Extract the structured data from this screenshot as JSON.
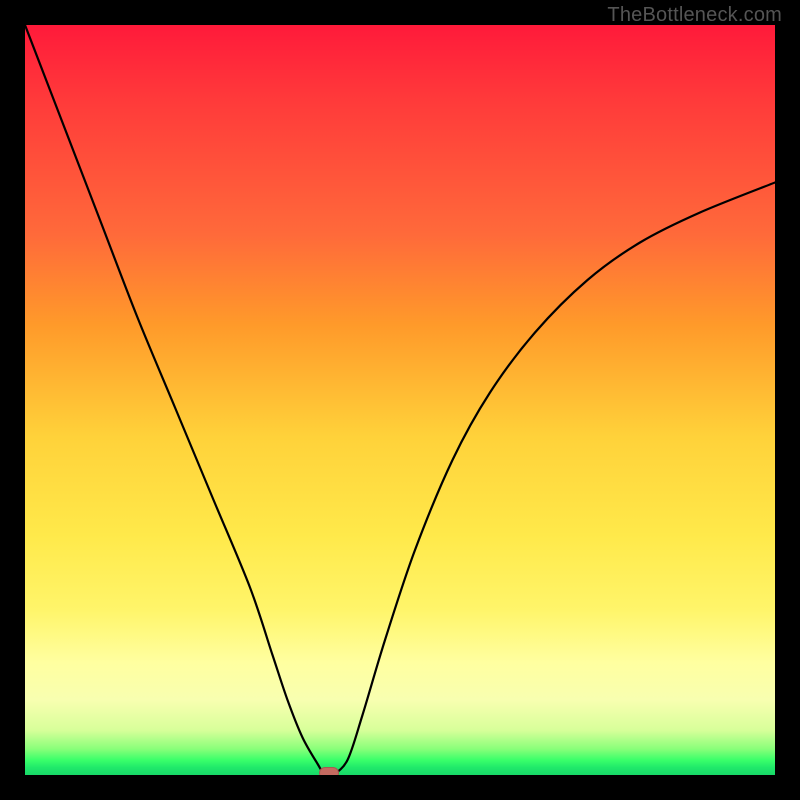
{
  "watermark": "TheBottleneck.com",
  "colors": {
    "background": "#000000",
    "gradient_top": "#ff1a3a",
    "gradient_mid": "#ffe94a",
    "gradient_bottom": "#18d868",
    "curve": "#000000",
    "marker": "#c46a60"
  },
  "chart_data": {
    "type": "line",
    "title": "",
    "xlabel": "",
    "ylabel": "",
    "xlim": [
      0,
      100
    ],
    "ylim": [
      0,
      100
    ],
    "grid": false,
    "legend": false,
    "series": [
      {
        "name": "bottleneck-curve",
        "x": [
          0,
          5,
          10,
          15,
          20,
          25,
          30,
          33,
          35,
          37,
          39,
          40,
          41,
          43,
          45,
          48,
          52,
          57,
          62,
          68,
          75,
          82,
          90,
          100
        ],
        "values": [
          100,
          87,
          74,
          61,
          49,
          37,
          25,
          16,
          10,
          5,
          1.5,
          0,
          0,
          2,
          8,
          18,
          30,
          42,
          51,
          59,
          66,
          71,
          75,
          79
        ]
      }
    ],
    "annotations": [
      {
        "name": "optimal-point",
        "x": 40.5,
        "y": 0
      }
    ],
    "gradient_stops": [
      {
        "pos": 0,
        "color": "#ff1a3a"
      },
      {
        "pos": 0.28,
        "color": "#ff6a3a"
      },
      {
        "pos": 0.55,
        "color": "#ffd23a"
      },
      {
        "pos": 0.78,
        "color": "#fff56a"
      },
      {
        "pos": 0.9,
        "color": "#f8ffb0"
      },
      {
        "pos": 0.965,
        "color": "#8aff7a"
      },
      {
        "pos": 1.0,
        "color": "#18d868"
      }
    ]
  }
}
